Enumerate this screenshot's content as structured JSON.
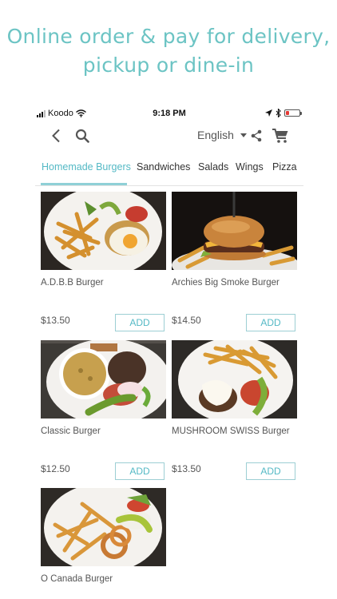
{
  "headline": {
    "line1": "Online order & pay for delivery,",
    "line2": "pickup or dine-in"
  },
  "status_bar": {
    "carrier": "Koodo",
    "time": "9:18 PM"
  },
  "toolbar": {
    "language": "English"
  },
  "tabs": [
    {
      "label": "Homemade Burgers",
      "active": true
    },
    {
      "label": "Sandwiches",
      "active": false
    },
    {
      "label": "Salads",
      "active": false
    },
    {
      "label": "Wings",
      "active": false
    },
    {
      "label": "Pizza",
      "active": false
    }
  ],
  "menu_items": [
    {
      "name": "A.D.B.B Burger",
      "price": "$13.50",
      "add_label": "ADD"
    },
    {
      "name": "Archies Big Smoke Burger",
      "price": "$14.50",
      "add_label": "ADD"
    },
    {
      "name": "Classic Burger",
      "price": "$12.50",
      "add_label": "ADD"
    },
    {
      "name": "MUSHROOM SWISS Burger",
      "price": "$13.50",
      "add_label": "ADD"
    },
    {
      "name": "O Canada Burger"
    }
  ],
  "colors": {
    "accent": "#6cc4c4",
    "tab_active": "#54b9c5",
    "button_border": "#9dcfd4",
    "battery_low": "#e53935"
  },
  "icons": [
    "back-arrow-icon",
    "search-icon",
    "dropdown-caret-icon",
    "share-icon",
    "cart-icon",
    "wifi-icon",
    "location-arrow-icon",
    "bluetooth-icon",
    "battery-icon"
  ]
}
